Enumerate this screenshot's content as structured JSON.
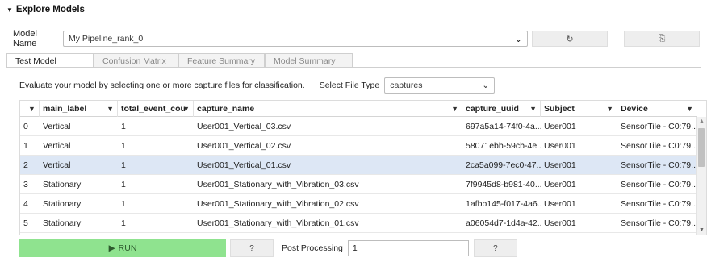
{
  "section": {
    "title": "Explore Models"
  },
  "model": {
    "label": "Model Name",
    "selected": "My Pipeline_rank_0",
    "refresh_icon": "↻",
    "copy_icon": "⎘"
  },
  "tabs": [
    {
      "label": "Test Model",
      "active": true
    },
    {
      "label": "Confusion Matrix",
      "active": false
    },
    {
      "label": "Feature Summary",
      "active": false
    },
    {
      "label": "Model Summary",
      "active": false
    }
  ],
  "evaluate": {
    "text": "Evaluate your model by selecting one or more capture files for classification.",
    "file_type_label": "Select File Type",
    "file_type_value": "captures"
  },
  "table": {
    "columns": [
      "",
      "main_label",
      "total_event_count",
      "capture_name",
      "capture_uuid",
      "Subject",
      "Device"
    ],
    "rows": [
      {
        "idx": "0",
        "main_label": "Vertical",
        "count": "1",
        "capture_name": "User001_Vertical_03.csv",
        "uuid": "697a5a14-74f0-4a...",
        "subject": "User001",
        "device": "SensorTile - C0:79...",
        "selected": false
      },
      {
        "idx": "1",
        "main_label": "Vertical",
        "count": "1",
        "capture_name": "User001_Vertical_02.csv",
        "uuid": "58071ebb-59cb-4e...",
        "subject": "User001",
        "device": "SensorTile - C0:79...",
        "selected": false
      },
      {
        "idx": "2",
        "main_label": "Vertical",
        "count": "1",
        "capture_name": "User001_Vertical_01.csv",
        "uuid": "2ca5a099-7ec0-47...",
        "subject": "User001",
        "device": "SensorTile - C0:79...",
        "selected": true
      },
      {
        "idx": "3",
        "main_label": "Stationary",
        "count": "1",
        "capture_name": "User001_Stationary_with_Vibration_03.csv",
        "uuid": "7f9945d8-b981-40...",
        "subject": "User001",
        "device": "SensorTile - C0:79...",
        "selected": false
      },
      {
        "idx": "4",
        "main_label": "Stationary",
        "count": "1",
        "capture_name": "User001_Stationary_with_Vibration_02.csv",
        "uuid": "1afbb145-f017-4a6...",
        "subject": "User001",
        "device": "SensorTile - C0:79...",
        "selected": false
      },
      {
        "idx": "5",
        "main_label": "Stationary",
        "count": "1",
        "capture_name": "User001_Stationary_with_Vibration_01.csv",
        "uuid": "a06054d7-1d4a-42...",
        "subject": "User001",
        "device": "SensorTile - C0:79...",
        "selected": false
      }
    ]
  },
  "bottom": {
    "run_label": "RUN",
    "run_icon": "▶",
    "help_label": "?",
    "post_processing_label": "Post Processing",
    "post_processing_value": "1",
    "help2_label": "?"
  },
  "colors": {
    "run_bg": "#8fe38f",
    "selected_row": "#dde7f5"
  }
}
